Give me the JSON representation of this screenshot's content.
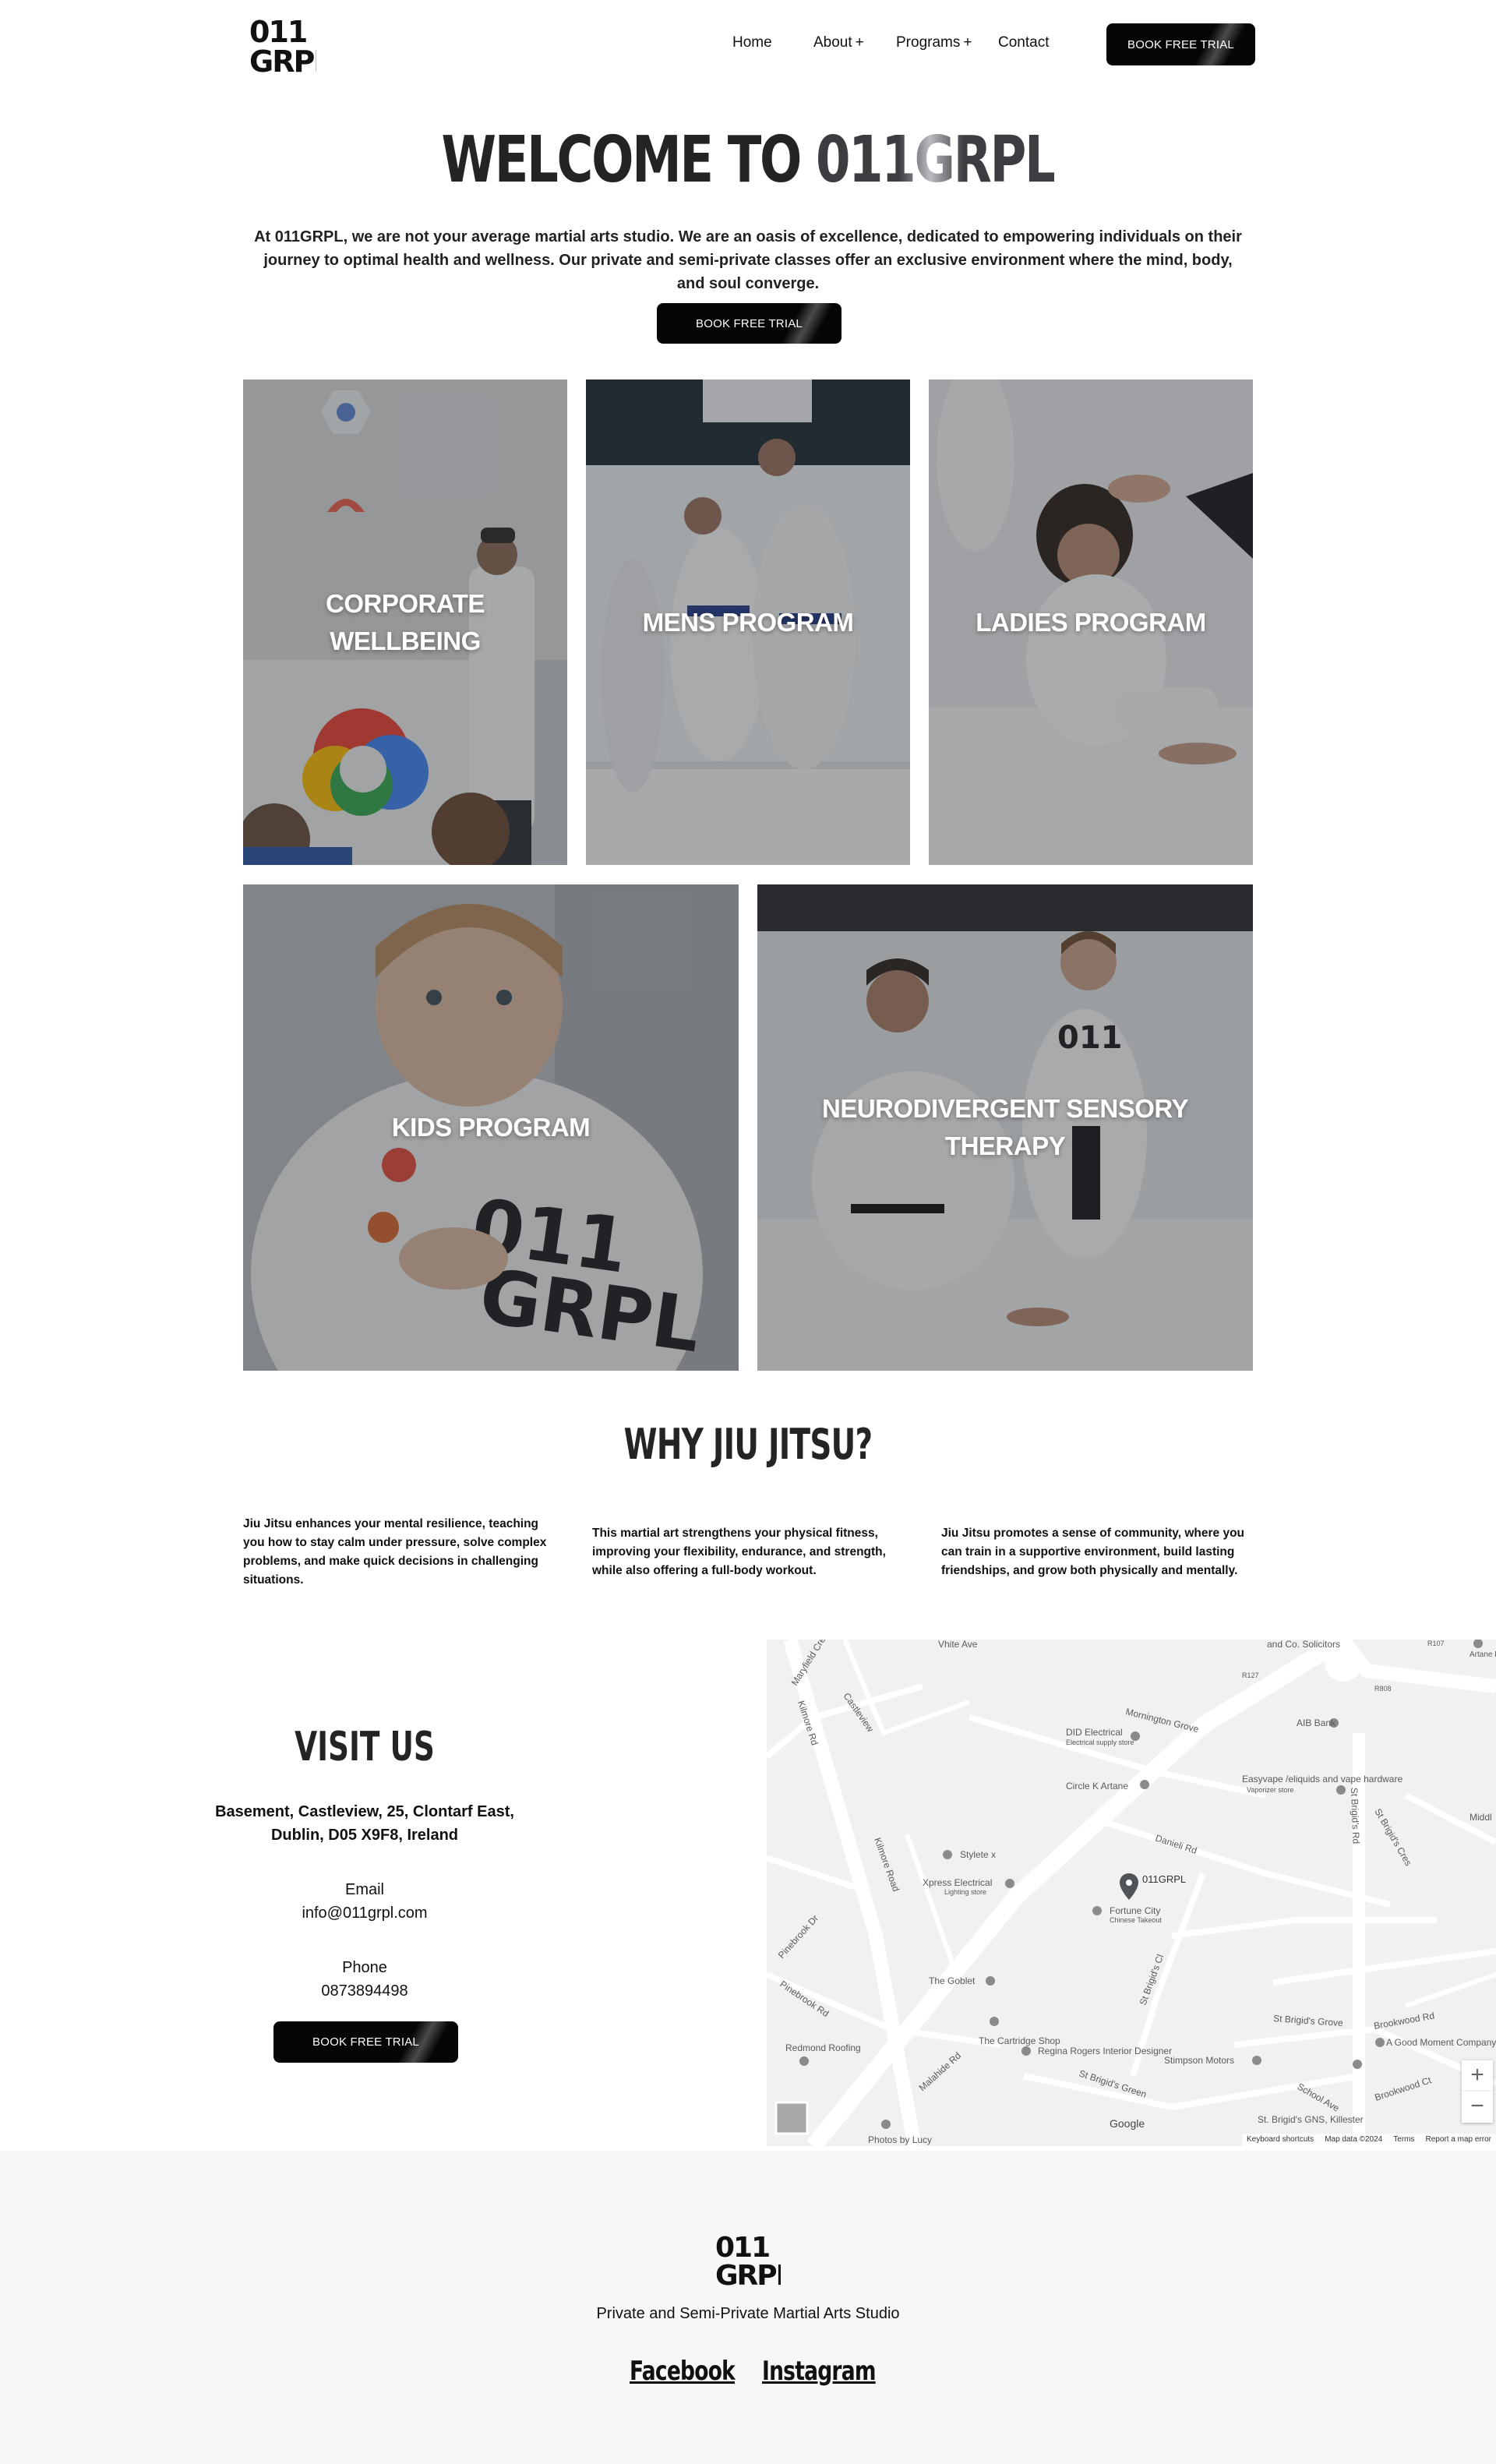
{
  "header": {
    "logo_text_top": "011",
    "logo_text_bottom": "GRPL",
    "nav": [
      {
        "label": "Home",
        "has_submenu": false
      },
      {
        "label": "About",
        "has_submenu": true
      },
      {
        "label": "Programs",
        "has_submenu": true
      },
      {
        "label": "Contact",
        "has_submenu": false
      }
    ],
    "submenu_marker": "+",
    "cta_label": "BOOK FREE TRIAL"
  },
  "hero": {
    "title_prefix": "WELCOME TO ",
    "title_brand": "011GRPL",
    "intro": "At 011GRPL, we are not your average martial arts studio. We are an oasis of excellence, dedicated to empowering individuals on their journey to optimal health and wellness. Our private and semi-private classes offer an exclusive environment where the mind, body, and soul converge.",
    "cta_label": "BOOK FREE TRIAL"
  },
  "programs": [
    {
      "label": "CORPORATE WELLBEING"
    },
    {
      "label": "MENS PROGRAM"
    },
    {
      "label": "LADIES PROGRAM"
    },
    {
      "label": "KIDS PROGRAM"
    },
    {
      "label": "NEURODIVERGENT SENSORY THERAPY"
    }
  ],
  "why": {
    "title": "WHY JIU JITSU?",
    "columns": [
      "Jiu Jitsu enhances your mental resilience, teaching you how to stay calm under pressure, solve complex problems, and make quick decisions in challenging situations.",
      "This martial art strengthens your physical fitness, improving your flexibility, endurance, and strength, while also offering a full-body workout.",
      "Jiu Jitsu promotes a sense of community, where you can train in a supportive environment, build lasting friendships, and grow both physically and mentally."
    ]
  },
  "visit": {
    "title": "VISIT US",
    "address": "Basement, Castleview, 25, Clontarf East, Dublin, D05 X9F8, Ireland",
    "email_label": "Email",
    "email": "info@011grpl.com",
    "phone_label": "Phone",
    "phone": "0873894498",
    "cta_label": "BOOK FREE TRIAL"
  },
  "map": {
    "marker_label": "011GRPL",
    "places": [
      "DID Electrical",
      "Electrical supply store",
      "AIB Bank",
      "Circle K Artane",
      "Easyvape /eliquids and vape hardware",
      "Vaporizer store",
      "Stylete x",
      "Xpress Electrical",
      "Lighting store",
      "Fortune City",
      "Chinese Takeout",
      "The Goblet",
      "The Cartridge Shop",
      "Regina Rogers Interior Designer",
      "Stimpson Motors",
      "A Good Moment Company",
      "Redmond Roofing",
      "St. Brigid's GNS, Killester",
      "Photos by Lucy",
      "and Co. Solicitors",
      "Artane Bicycle"
    ],
    "streets": [
      "Maryfield Cres",
      "Kilmore Rd",
      "Castleview",
      "Mornington Grove",
      "St Brigid's Rd",
      "St Brigid's Cres",
      "Danieli Rd",
      "Kilmore Road",
      "Pinebrook Dr",
      "Pinebrook Rd",
      "Malahide Rd",
      "St Brigid's Cl",
      "St Brigid's Green",
      "St Brigid's Grove",
      "Brookwood Rd",
      "School Ave",
      "Brookwood Ct",
      "Vhite Ave",
      "Middl",
      "R107",
      "R808",
      "R127"
    ],
    "zoom_in": "+",
    "zoom_out": "−",
    "google": "Google",
    "footer_links": [
      "Keyboard shortcuts",
      "Map data ©2024",
      "Terms",
      "Report a map error"
    ]
  },
  "footer": {
    "logo_text_top": "011",
    "logo_text_bottom": "GRPL",
    "tagline": "Private and Semi-Private Martial Arts Studio",
    "social": [
      "Facebook",
      "Instagram"
    ]
  },
  "colors": {
    "accent": "#050505",
    "text": "#1f2124",
    "footer_bg": "#f6f7f9",
    "map_bg": "#f1f1f1"
  }
}
